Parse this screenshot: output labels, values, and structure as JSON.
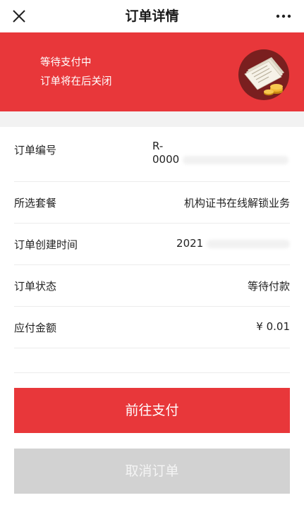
{
  "header": {
    "title": "订单详情",
    "close_icon": "close-icon",
    "more_icon": "more-icon"
  },
  "banner": {
    "status": "等待支付中",
    "notice": "订单将在后关闭",
    "background_color": "#e8373a",
    "illustration": "receipt-coins-icon"
  },
  "order": {
    "rows": [
      {
        "label": "订单编号",
        "value_prefix": "R-",
        "value_line2_prefix": "0000"
      },
      {
        "label": "所选套餐",
        "value": "机构证书在线解锁业务"
      },
      {
        "label": "订单创建时间",
        "value_prefix": "2021"
      },
      {
        "label": "订单状态",
        "value": "等待付款"
      },
      {
        "label": "应付金额",
        "value": "¥ 0.01"
      }
    ]
  },
  "actions": {
    "pay_label": "前往支付",
    "cancel_label": "取消订单",
    "pay_color": "#e8373a",
    "cancel_color": "#d2d2d2"
  }
}
